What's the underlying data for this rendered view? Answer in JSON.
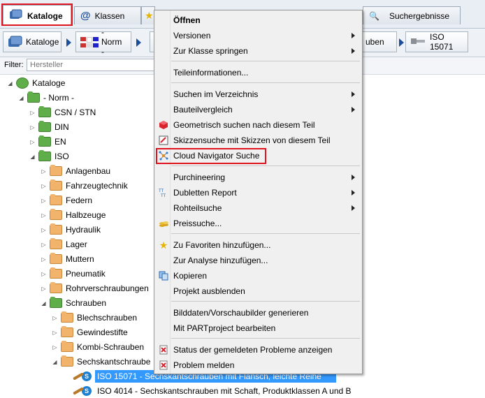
{
  "tabs": [
    {
      "label": "Kataloge",
      "icon": "catalog-icon",
      "active": true
    },
    {
      "label": "Klassen",
      "icon": "at-icon",
      "active": false
    },
    {
      "label": "Suchergebnisse",
      "icon": "search-icon",
      "active": false
    }
  ],
  "breadcrumb": [
    {
      "label": "Kataloge"
    },
    {
      "label": "- Norm -"
    },
    {
      "label": "uben"
    },
    {
      "label": "ISO 15071"
    }
  ],
  "filter": {
    "label": "Filter:",
    "placeholder": "Hersteller"
  },
  "tree": [
    {
      "label": "Kataloge",
      "indent": 0,
      "icon": "catalog"
    },
    {
      "label": "- Norm -",
      "indent": 1,
      "icon": "green"
    },
    {
      "label": "CSN / STN",
      "indent": 2,
      "icon": "green"
    },
    {
      "label": "DIN",
      "indent": 2,
      "icon": "green"
    },
    {
      "label": "EN",
      "indent": 2,
      "icon": "green"
    },
    {
      "label": "ISO",
      "indent": 2,
      "icon": "green"
    },
    {
      "label": "Anlagenbau",
      "indent": 3,
      "icon": "orange"
    },
    {
      "label": "Fahrzeugtechnik",
      "indent": 3,
      "icon": "orange"
    },
    {
      "label": "Federn",
      "indent": 3,
      "icon": "orange"
    },
    {
      "label": "Halbzeuge",
      "indent": 3,
      "icon": "orange"
    },
    {
      "label": "Hydraulik",
      "indent": 3,
      "icon": "orange"
    },
    {
      "label": "Lager",
      "indent": 3,
      "icon": "orange"
    },
    {
      "label": "Muttern",
      "indent": 3,
      "icon": "orange"
    },
    {
      "label": "Pneumatik",
      "indent": 3,
      "icon": "orange"
    },
    {
      "label": "Rohrverschraubungen",
      "indent": 3,
      "icon": "orange"
    },
    {
      "label": "Schrauben",
      "indent": 3,
      "icon": "green"
    },
    {
      "label": "Blechschrauben",
      "indent": 4,
      "icon": "orange"
    },
    {
      "label": "Gewindestifte",
      "indent": 4,
      "icon": "orange"
    },
    {
      "label": "Kombi-Schrauben",
      "indent": 4,
      "icon": "orange"
    },
    {
      "label": "Sechskantschraube",
      "indent": 4,
      "icon": "orange"
    }
  ],
  "parts": [
    {
      "label": "ISO 15071 - Sechskantschrauben mit Flansch, leichte Reihe",
      "selected": true
    },
    {
      "label": "ISO 4014 - Sechskantschrauben mit Schaft, Produktklassen A und B",
      "selected": false
    }
  ],
  "menu": {
    "items": [
      {
        "label": "Öffnen",
        "bold": true,
        "sub": false,
        "icon": ""
      },
      {
        "label": "Versionen",
        "sub": true,
        "icon": ""
      },
      {
        "label": "Zur Klasse springen",
        "sub": true,
        "icon": ""
      },
      {
        "sep": true
      },
      {
        "label": "Teileinformationen...",
        "sub": false,
        "icon": ""
      },
      {
        "sep": true
      },
      {
        "label": "Suchen im Verzeichnis",
        "sub": true,
        "icon": ""
      },
      {
        "label": "Bauteilvergleich",
        "sub": true,
        "icon": ""
      },
      {
        "label": "Geometrisch suchen nach diesem Teil",
        "sub": false,
        "icon": "cube-icon"
      },
      {
        "label": "Skizzensuche mit Skizzen von diesem Teil",
        "sub": false,
        "icon": "sketch-icon"
      },
      {
        "label": "Cloud Navigator Suche",
        "sub": false,
        "icon": "network-icon",
        "highlight": true
      },
      {
        "sep": true
      },
      {
        "label": "Purchineering",
        "sub": true,
        "icon": ""
      },
      {
        "label": "Dubletten Report",
        "sub": true,
        "icon": "duplicates-icon"
      },
      {
        "label": "Rohteilsuche",
        "sub": true,
        "icon": ""
      },
      {
        "label": "Preissuche...",
        "sub": false,
        "icon": "coins-icon"
      },
      {
        "sep": true
      },
      {
        "label": "Zu Favoriten hinzufügen...",
        "sub": false,
        "icon": "star-icon"
      },
      {
        "label": "Zur Analyse hinzufügen...",
        "sub": false,
        "icon": ""
      },
      {
        "label": "Kopieren",
        "sub": false,
        "icon": "copy-icon"
      },
      {
        "label": "Projekt ausblenden",
        "sub": false,
        "icon": ""
      },
      {
        "sep": true
      },
      {
        "label": "Bilddaten/Vorschaubilder generieren",
        "sub": false,
        "icon": ""
      },
      {
        "label": "Mit PARTproject bearbeiten",
        "sub": false,
        "icon": ""
      },
      {
        "sep": true
      },
      {
        "label": "Status der gemeldeten Probleme anzeigen",
        "sub": false,
        "icon": "report-icon"
      },
      {
        "label": "Problem melden",
        "sub": false,
        "icon": "report-icon"
      }
    ]
  },
  "colors": {
    "highlight": "#e0141e",
    "selection": "#3399ff",
    "accent": "#1b4f9c"
  }
}
